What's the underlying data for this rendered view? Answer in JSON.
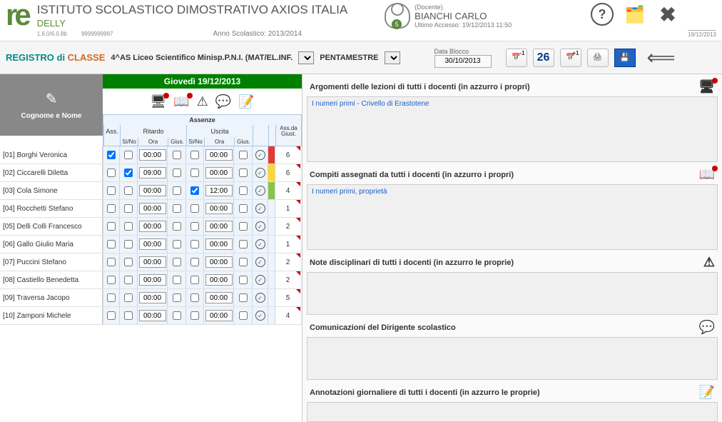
{
  "header": {
    "school": "ISTITUTO SCOLASTICO DIMOSTRATIVO AXIOS ITALIA",
    "org": "DELLY",
    "version": "1.6.0/6.0.8b",
    "code": "9999999997",
    "year_label": "Anno Scolastico: 2013/2014",
    "user_role": "(Docente)",
    "user_name": "BIANCHI CARLO",
    "last_access": "Ultimo Accesso: 19/12/2013 11:50",
    "user_badge": "5",
    "date_stamp": "19/12/2013"
  },
  "subheader": {
    "title_a": "REGISTRO di ",
    "title_b": "CLASSE",
    "class": "4^AS Liceo Scientifico Minisp.P.N.I. (MAT/EL.INF.",
    "period": "PENTAMESTRE",
    "data_blocco_label": "Data Blocco",
    "data_blocco_value": "30/10/2013",
    "nav_prev": "-1",
    "nav_today": "26",
    "nav_next": "+1"
  },
  "date_bar": "Giovedì 19/12/2013",
  "corner_label": "Cognome e Nome",
  "abs_label": "Assenze",
  "headers": {
    "ass": "Ass.",
    "ritardo": "Ritardo",
    "uscita": "Uscita",
    "sino": "Si/No",
    "ora": "Ora",
    "gius": "Gius.",
    "assda": "Ass.da Giust."
  },
  "students": [
    {
      "id": "[01]",
      "name": "Borghi Veronica",
      "ass": true,
      "rSi": false,
      "rOra": "00:00",
      "rG": false,
      "uSi": false,
      "uOra": "00:00",
      "uG": false,
      "color": "red",
      "count": "6"
    },
    {
      "id": "[02]",
      "name": "Ciccarelli Diletta",
      "ass": false,
      "rSi": true,
      "rOra": "09:00",
      "rG": false,
      "uSi": false,
      "uOra": "00:00",
      "uG": false,
      "color": "yellow",
      "count": "6"
    },
    {
      "id": "[03]",
      "name": "Cola Simone",
      "ass": false,
      "rSi": false,
      "rOra": "00:00",
      "rG": false,
      "uSi": true,
      "uOra": "12:00",
      "uG": false,
      "color": "green",
      "count": "4"
    },
    {
      "id": "[04]",
      "name": "Rocchetti Stefano",
      "ass": false,
      "rSi": false,
      "rOra": "00:00",
      "rG": false,
      "uSi": false,
      "uOra": "00:00",
      "uG": false,
      "color": "",
      "count": "1"
    },
    {
      "id": "[05]",
      "name": "Delli Colli Francesco",
      "ass": false,
      "rSi": false,
      "rOra": "00:00",
      "rG": false,
      "uSi": false,
      "uOra": "00:00",
      "uG": false,
      "color": "",
      "count": "2"
    },
    {
      "id": "[06]",
      "name": "Gallo Giulio Maria",
      "ass": false,
      "rSi": false,
      "rOra": "00:00",
      "rG": false,
      "uSi": false,
      "uOra": "00:00",
      "uG": false,
      "color": "",
      "count": "1"
    },
    {
      "id": "[07]",
      "name": "Puccini Stefano",
      "ass": false,
      "rSi": false,
      "rOra": "00:00",
      "rG": false,
      "uSi": false,
      "uOra": "00:00",
      "uG": false,
      "color": "",
      "count": "2"
    },
    {
      "id": "[08]",
      "name": "Castiello Benedetta",
      "ass": false,
      "rSi": false,
      "rOra": "00:00",
      "rG": false,
      "uSi": false,
      "uOra": "00:00",
      "uG": false,
      "color": "",
      "count": "2"
    },
    {
      "id": "[09]",
      "name": "Traversa Jacopo",
      "ass": false,
      "rSi": false,
      "rOra": "00:00",
      "rG": false,
      "uSi": false,
      "uOra": "00:00",
      "uG": false,
      "color": "",
      "count": "5"
    },
    {
      "id": "[10]",
      "name": "Zamponi Michele",
      "ass": false,
      "rSi": false,
      "rOra": "00:00",
      "rG": false,
      "uSi": false,
      "uOra": "00:00",
      "uG": false,
      "color": "",
      "count": "4"
    }
  ],
  "panels": {
    "argomenti": {
      "title": "Argomenti delle lezioni di tutti i docenti (in azzurro i propri)",
      "content": "I numeri primi - Crivello di Erastotene"
    },
    "compiti": {
      "title": "Compiti assegnati da tutti i docenti (in azzurro i propri)",
      "content": "I numeri primi, proprietà"
    },
    "note": {
      "title": "Note disciplinari di tutti i docenti (in azzurro le proprie)",
      "content": ""
    },
    "comunicazioni": {
      "title": "Comunicazioni del Dirigente scolastico",
      "content": ""
    },
    "annotazioni": {
      "title": "Annotazioni giornaliere di tutti i docenti (in azzurro le proprie)",
      "content": ""
    }
  }
}
